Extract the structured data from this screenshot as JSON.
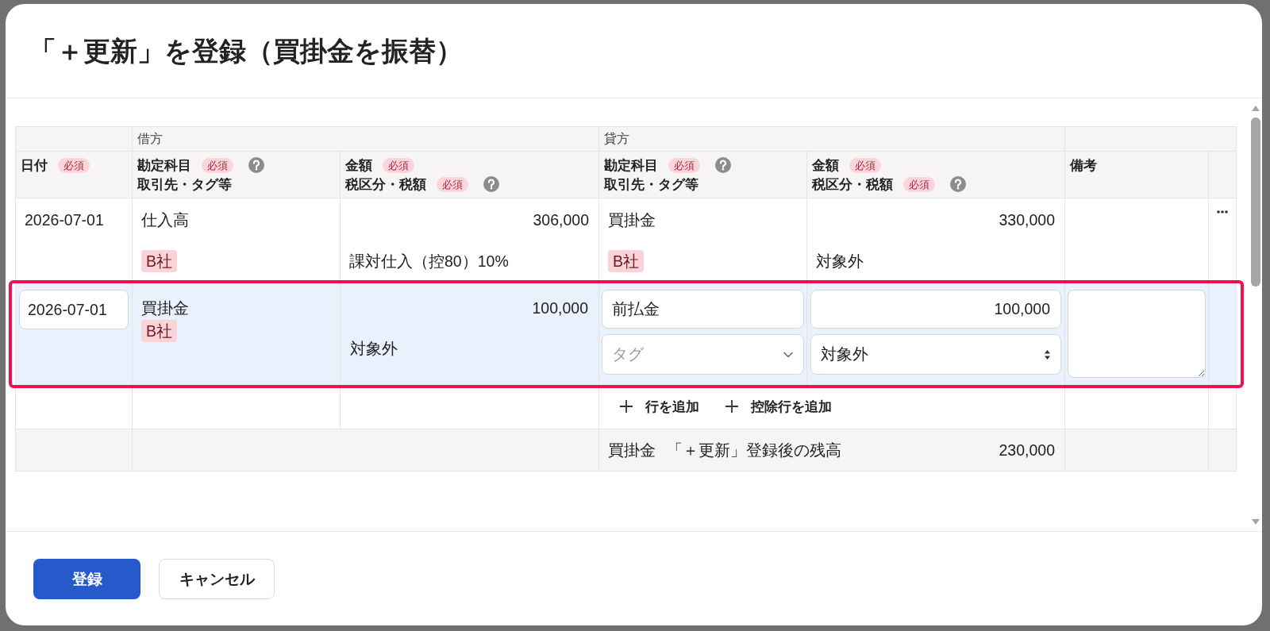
{
  "dialog": {
    "title": "「＋更新」を登録（買掛金を振替）"
  },
  "table": {
    "column_groups": [
      "借方",
      "貸方"
    ],
    "columns": [
      {
        "lines": [
          {
            "label": "日付",
            "badge": "必須",
            "help": false
          }
        ]
      },
      {
        "lines": [
          {
            "label": "勘定科目",
            "badge": "必須",
            "help": true
          },
          {
            "label": "取引先・タグ等",
            "help": false
          }
        ]
      },
      {
        "lines": [
          {
            "label": "金額",
            "badge": "必須",
            "help": false
          },
          {
            "label": "税区分・税額",
            "badge": "必須",
            "help": true
          }
        ]
      },
      {
        "lines": [
          {
            "label": "勘定科目",
            "badge": "必須",
            "help": true
          },
          {
            "label": "取引先・タグ等",
            "help": false
          }
        ]
      },
      {
        "lines": [
          {
            "label": "金額",
            "badge": "必須",
            "help": false
          },
          {
            "label": "税区分・税額",
            "badge": "必須",
            "help": true
          }
        ]
      },
      {
        "lines": [
          {
            "label": "備考",
            "help": false
          }
        ]
      }
    ],
    "rows": [
      {
        "kind": "display",
        "highlighted": false,
        "date": "2026-07-01",
        "debit": {
          "account": "仕入高",
          "tag": "B社",
          "amount": "306,000",
          "tax": "課対仕入（控80）10%"
        },
        "credit": {
          "account": "買掛金",
          "tag": "B社",
          "amount": "330,000",
          "tax": "対象外"
        },
        "menu": true
      },
      {
        "kind": "edit",
        "highlighted": true,
        "date": "2026-07-01",
        "debit": {
          "account": "買掛金",
          "tag": "B社",
          "amount": "100,000",
          "tax": "対象外"
        },
        "credit": {
          "account": "前払金",
          "tag_field": {
            "placeholder": "タグ"
          },
          "amount": "100,000",
          "tax": "対象外"
        },
        "menu": false
      }
    ],
    "add_actions": [
      "行を追加",
      "控除行を追加"
    ],
    "summary": {
      "account": "買掛金",
      "label": "「＋更新」登録後の残高",
      "amount": "230,000"
    }
  },
  "buttons": [
    {
      "label": "登録",
      "kind": "primary"
    },
    {
      "label": "キャンセル",
      "kind": "secondary"
    }
  ]
}
